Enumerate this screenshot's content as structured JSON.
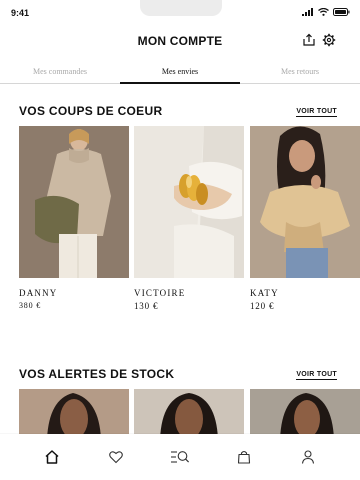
{
  "status_bar": {
    "time": "9:41"
  },
  "header": {
    "title": "MON COMPTE"
  },
  "tabs": [
    {
      "label": "Mes commandes",
      "active": false
    },
    {
      "label": "Mes envies",
      "active": true
    },
    {
      "label": "Mes retours",
      "active": false
    }
  ],
  "favorites": {
    "title": "VOS COUPS DE COEUR",
    "see_all": "VOIR TOUT",
    "items": [
      {
        "name": "DANNY",
        "price": "380 €"
      },
      {
        "name": "VICTOIRE",
        "price": "130 €"
      },
      {
        "name": "KATY",
        "price": "120 €"
      }
    ]
  },
  "stock_alerts": {
    "title": "VOS ALERTES DE STOCK",
    "see_all": "VOIR TOUT"
  },
  "colors": {
    "accent": "#111111",
    "tab_inactive": "#a9a9a9",
    "photo_bg": "#c7b9a7"
  }
}
